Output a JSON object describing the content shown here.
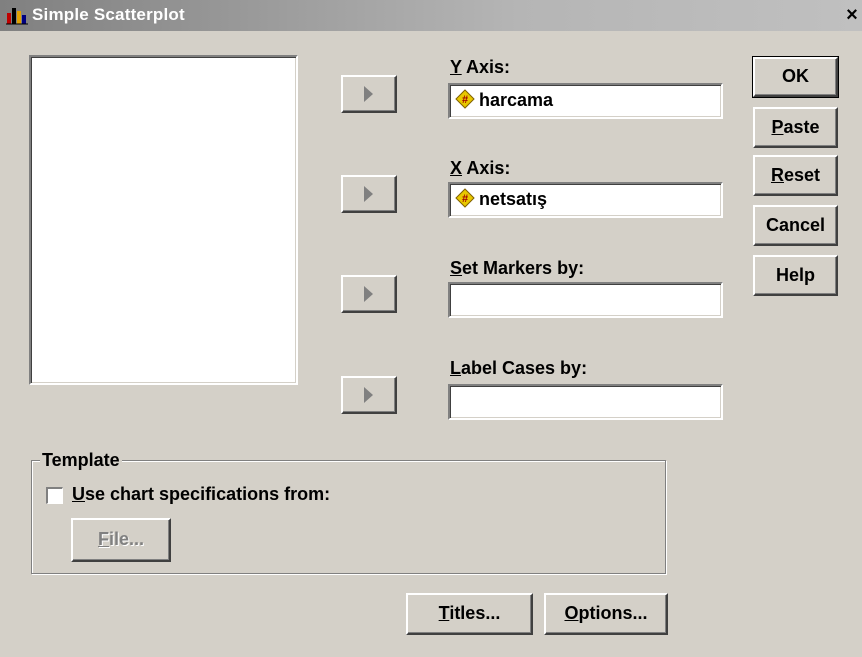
{
  "window": {
    "title": "Simple Scatterplot",
    "close_glyph": "×"
  },
  "source_list": {
    "items": []
  },
  "fields": {
    "y_axis": {
      "label_u": "Y",
      "label_rest": " Axis:",
      "value": "harcama",
      "icon": "scale-variable-icon"
    },
    "x_axis": {
      "label_u": "X",
      "label_rest": " Axis:",
      "value": "netsatış",
      "icon": "scale-variable-icon"
    },
    "set_markers_by": {
      "label_u": "S",
      "label_rest": "et Markers by:",
      "value": ""
    },
    "label_cases_by": {
      "label_u": "L",
      "label_rest": "abel Cases by:",
      "value": ""
    }
  },
  "buttons": {
    "ok": "OK",
    "paste_u": "P",
    "paste_rest": "aste",
    "reset_u": "R",
    "reset_rest": "eset",
    "cancel": "Cancel",
    "help": "Help",
    "titles_u": "T",
    "titles_rest": "itles...",
    "options_u": "O",
    "options_rest": "ptions..."
  },
  "template": {
    "legend": "Template",
    "checkbox_u": "U",
    "checkbox_rest": "se chart specifications from:",
    "checked": false,
    "file_u": "F",
    "file_rest": "ile..."
  },
  "colors": {
    "face": "#d4d0c8",
    "titlebar": "#808080",
    "variable_icon": "#e8c800"
  }
}
